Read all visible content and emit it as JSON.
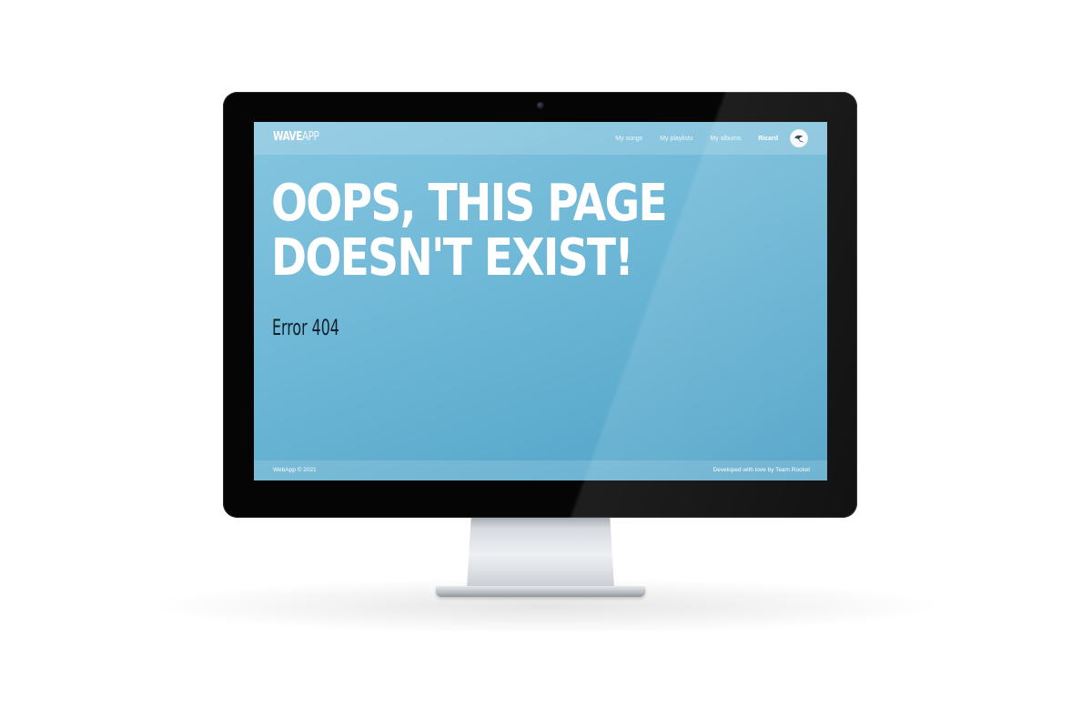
{
  "header": {
    "logo_bold": "WAVE",
    "logo_light": "APP",
    "nav": [
      {
        "label": "My songs"
      },
      {
        "label": "My playlists"
      },
      {
        "label": "My albums"
      }
    ],
    "user_name": "Ricard"
  },
  "main": {
    "headline": "OOPS, THIS PAGE DOESN'T EXIST!",
    "error_code": "Error 404"
  },
  "footer": {
    "copyright": "WebApp © 2021",
    "credit": "Developed with love by Team Rocket"
  },
  "colors": {
    "screen_top": "#86c6e0",
    "screen_bottom": "#4fa2c7",
    "headline": "#ffffff",
    "error_code": "#10202a",
    "bezel": "#050505"
  },
  "icons": {
    "avatar": "user-avatar-icon",
    "camera": "camera-icon"
  }
}
